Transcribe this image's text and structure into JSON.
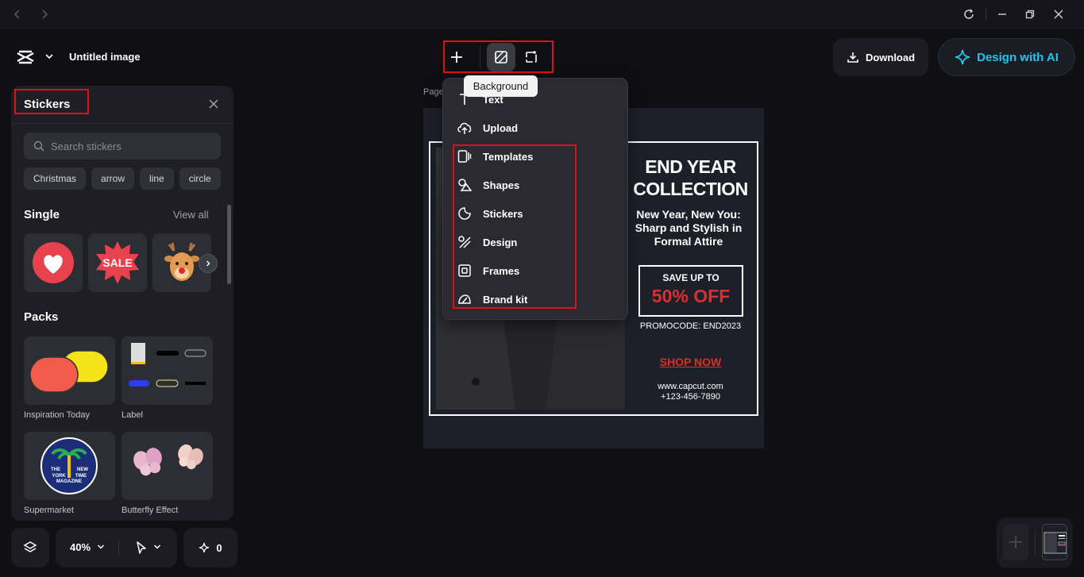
{
  "header": {
    "doc_title": "Untitled image",
    "download_label": "Download",
    "ai_label": "Design with AI"
  },
  "tooltip": "Background",
  "menu": {
    "items": [
      {
        "label": "Text",
        "icon": "text-icon"
      },
      {
        "label": "Upload",
        "icon": "upload-icon"
      },
      {
        "label": "Templates",
        "icon": "templates-icon"
      },
      {
        "label": "Shapes",
        "icon": "shapes-icon"
      },
      {
        "label": "Stickers",
        "icon": "stickers-icon"
      },
      {
        "label": "Design",
        "icon": "design-icon"
      },
      {
        "label": "Frames",
        "icon": "frames-icon"
      },
      {
        "label": "Brand kit",
        "icon": "brand-kit-icon"
      }
    ]
  },
  "panel": {
    "title": "Stickers",
    "search_placeholder": "Search stickers",
    "chips": [
      "Christmas",
      "arrow",
      "line",
      "circle"
    ],
    "single_title": "Single",
    "view_all": "View all",
    "singles": [
      "heart-sticker",
      "sale-sticker",
      "reindeer-sticker"
    ],
    "sale_text": "SALE",
    "packs_title": "Packs",
    "packs": [
      "Inspiration Today",
      "Label",
      "Supermarket",
      "Butterfly Effect"
    ],
    "badge_text": [
      "THE",
      "NEW",
      "YORK",
      "TIME",
      "MAGAZINE"
    ]
  },
  "bottom": {
    "zoom": "40%",
    "sparkle_count": "0"
  },
  "canvas": {
    "page_label": "Page",
    "heading_line1": "END YEAR",
    "heading_line2": "COLLECTION",
    "sub_line1": "New Year, New You:",
    "sub_line2": "Sharp and Stylish in",
    "sub_line3": "Formal Attire",
    "save_up": "SAVE UP TO",
    "discount": "50% OFF",
    "promo": "PROMOCODE: END2023",
    "shop": "SHOP NOW",
    "website": "www.capcut.com",
    "phone": "+123-456-7890"
  },
  "colors": {
    "accent_red": "#e0101a",
    "ai_blue": "#27c2ea",
    "offer_red": "#d8302f"
  }
}
